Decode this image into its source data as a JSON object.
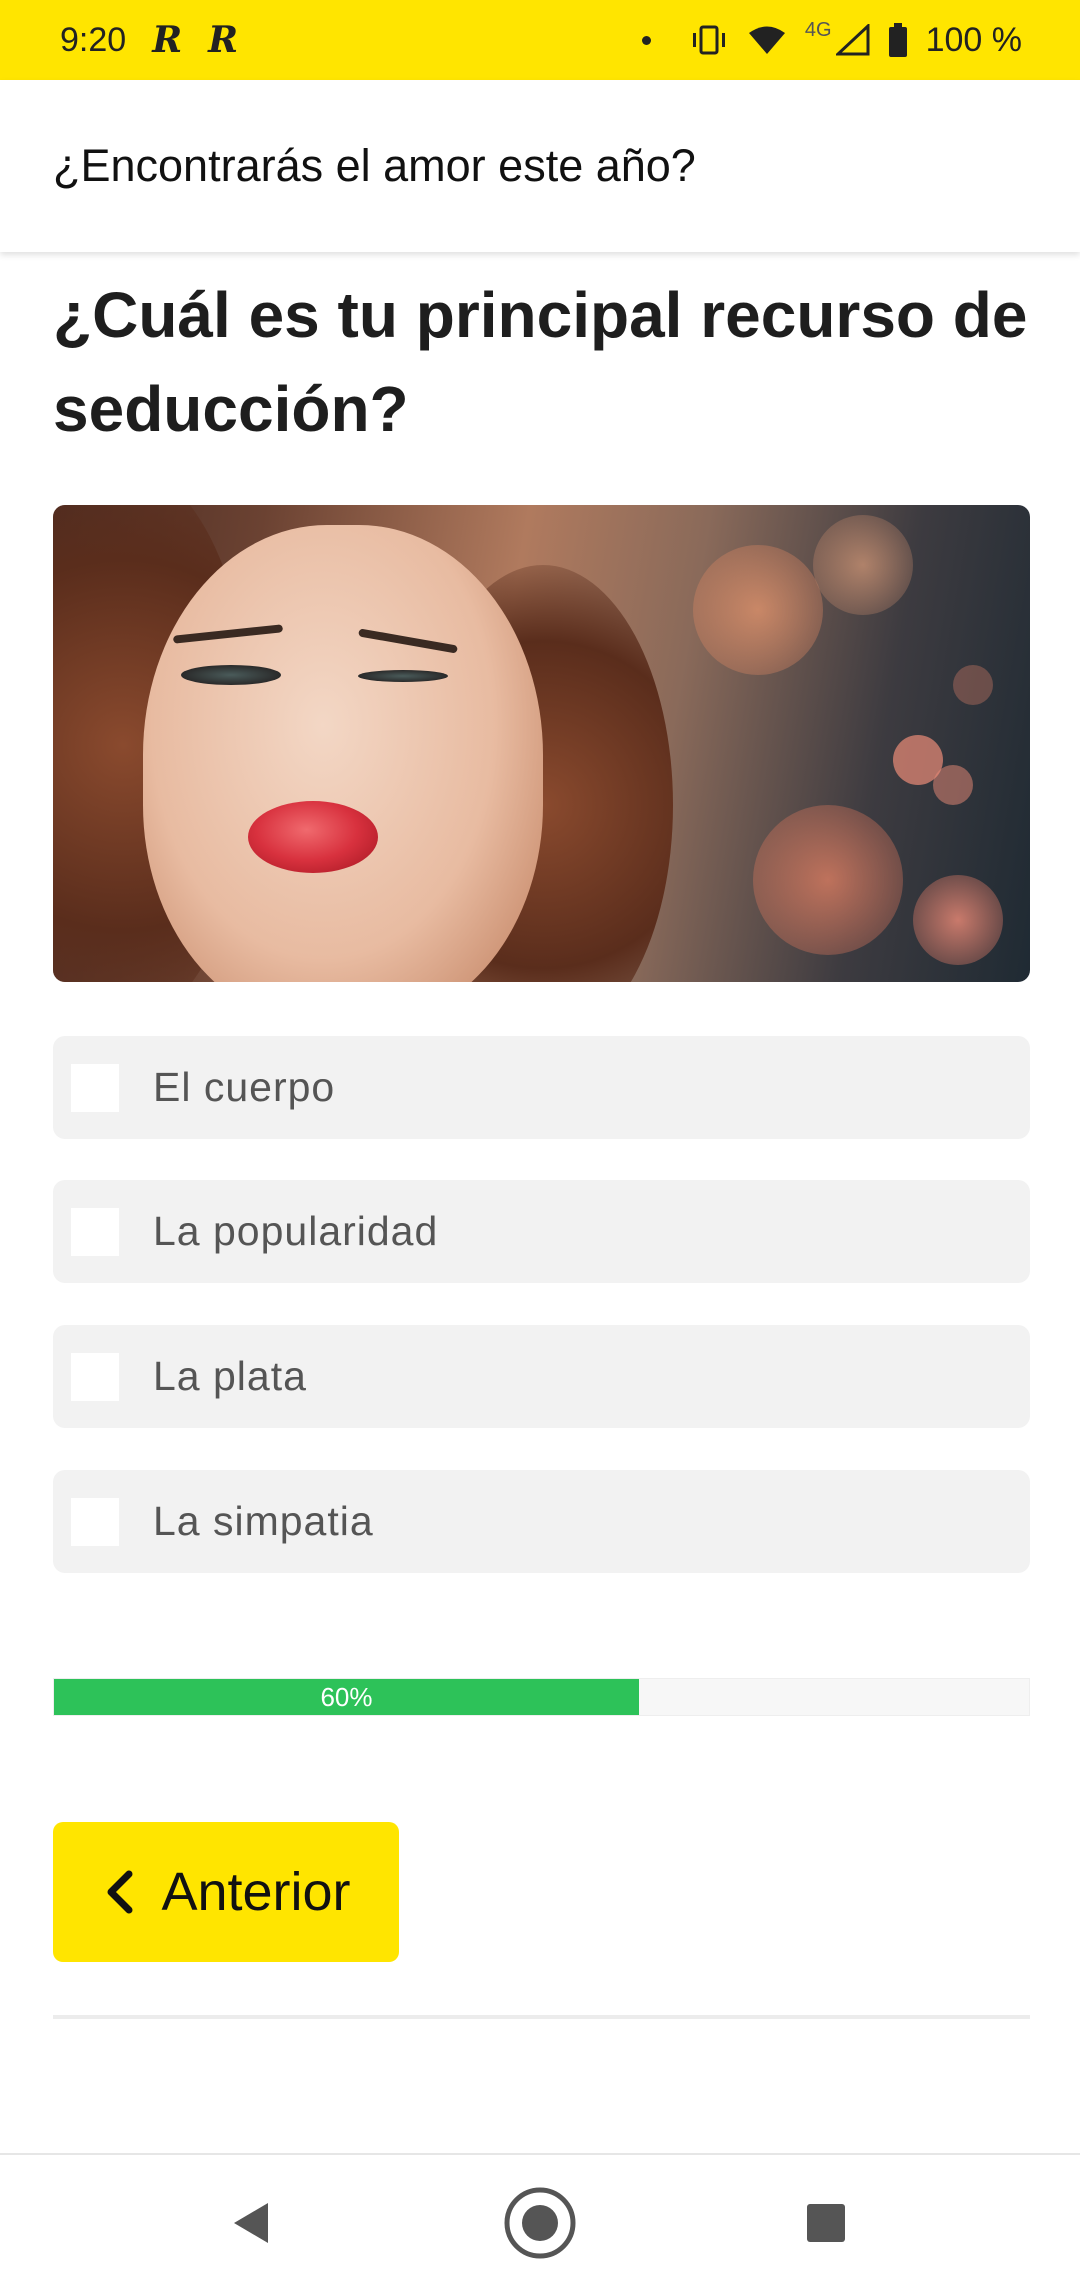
{
  "status_bar": {
    "time": "9:20",
    "notif_1": "R",
    "notif_2": "R",
    "network": "4G",
    "battery": "100 %"
  },
  "app_bar": {
    "title": "¿Encontrarás el amor este año?"
  },
  "quiz": {
    "question": "¿Cuál es tu principal recurso de seducción?",
    "options": [
      {
        "label": "El cuerpo",
        "checked": false
      },
      {
        "label": "La popularidad",
        "checked": false
      },
      {
        "label": "La plata",
        "checked": false
      },
      {
        "label": "La simpatia",
        "checked": false
      }
    ],
    "progress": {
      "percent": 60,
      "label": "60%"
    },
    "prev_button": {
      "label": "Anterior"
    }
  },
  "colors": {
    "accent_yellow": "#FFE500",
    "progress_green": "#2DC259"
  },
  "icons": {
    "prev": "chevron-left-icon",
    "nav_back": "back-triangle-icon",
    "nav_home": "home-circle-icon",
    "nav_recents": "recents-square-icon"
  }
}
